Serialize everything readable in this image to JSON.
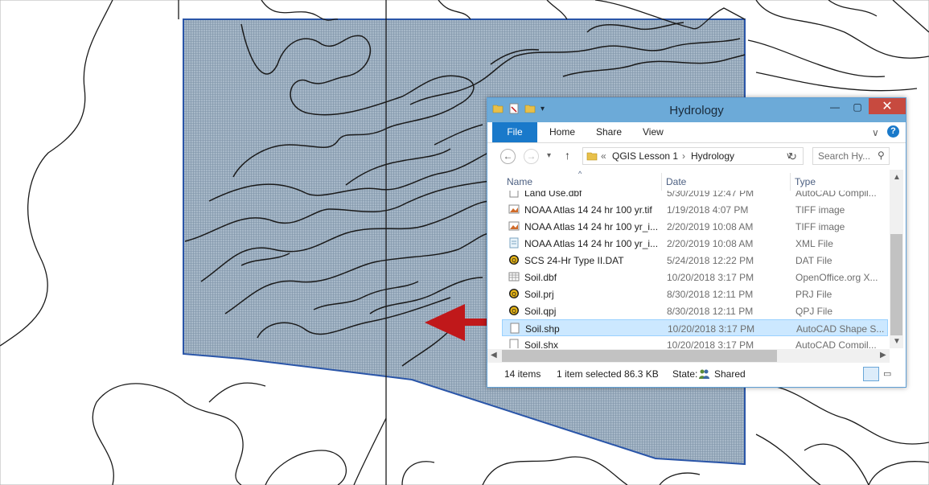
{
  "window": {
    "title": "Hydrology",
    "ribbon_tabs": [
      "File",
      "Home",
      "Share",
      "View"
    ],
    "address": {
      "overflow": "«",
      "crumbs": [
        "QGIS Lesson 1",
        "Hydrology"
      ],
      "sep": "›"
    },
    "search_placeholder": "Search Hy...",
    "columns": [
      "Name",
      "Date",
      "Type"
    ],
    "rows": [
      {
        "name": "Land Use.dbf",
        "date": "5/30/2019 12:47 PM",
        "type": "AutoCAD Compil...",
        "icon": "file-icon"
      },
      {
        "name": "NOAA Atlas 14 24 hr 100 yr.tif",
        "date": "1/19/2018 4:07 PM",
        "type": "TIFF image",
        "icon": "image-icon"
      },
      {
        "name": "NOAA Atlas 14 24 hr 100 yr_i...",
        "date": "2/20/2019 10:08 AM",
        "type": "TIFF image",
        "icon": "image-icon"
      },
      {
        "name": "NOAA Atlas 14 24 hr 100 yr_i...",
        "date": "2/20/2019 10:08 AM",
        "type": "XML File",
        "icon": "xml-icon"
      },
      {
        "name": "SCS 24-Hr Type II.DAT",
        "date": "5/24/2018 12:22 PM",
        "type": "DAT File",
        "icon": "app-icon"
      },
      {
        "name": "Soil.dbf",
        "date": "10/20/2018 3:17 PM",
        "type": "OpenOffice.org X...",
        "icon": "table-icon"
      },
      {
        "name": "Soil.prj",
        "date": "8/30/2018 12:11 PM",
        "type": "PRJ File",
        "icon": "app-icon"
      },
      {
        "name": "Soil.qpj",
        "date": "8/30/2018 12:11 PM",
        "type": "QPJ File",
        "icon": "app-icon"
      },
      {
        "name": "Soil.shp",
        "date": "10/20/2018 3:17 PM",
        "type": "AutoCAD Shape S...",
        "icon": "file-icon",
        "selected": true
      },
      {
        "name": "Soil.shx",
        "date": "10/20/2018 3:17 PM",
        "type": "AutoCAD Compil...",
        "icon": "file-icon"
      }
    ],
    "status": {
      "count": "14 items",
      "selection": "1 item selected  86.3 KB",
      "state_label": "State:",
      "state_value": "Shared"
    }
  },
  "colors": {
    "polygon_fill": "#9fb2c4",
    "polygon_stroke": "#2a55a8",
    "arrow": "#c0181a",
    "accent": "#1979ca"
  }
}
